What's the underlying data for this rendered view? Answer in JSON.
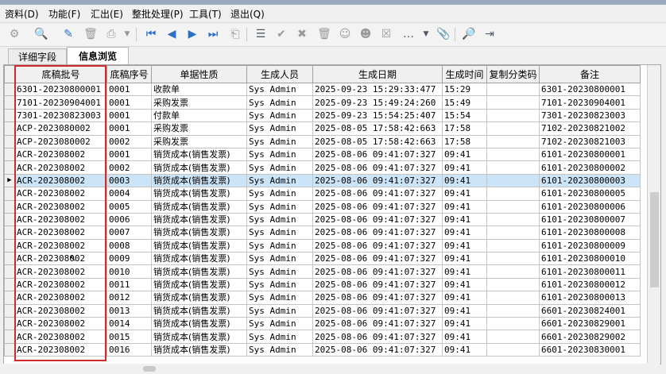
{
  "menu": [
    {
      "label": "资料(D)"
    },
    {
      "label": "功能(F)"
    },
    {
      "label": "汇出(E)"
    },
    {
      "label": "整批处理(P)"
    },
    {
      "label": "工具(T)"
    },
    {
      "label": "退出(Q)"
    }
  ],
  "tabs": [
    {
      "label": "详细字段"
    },
    {
      "label": "信息浏览"
    }
  ],
  "active_tab": "信息浏览",
  "columns": [
    "底稿批号",
    "底稿序号",
    "单据性质",
    "生成人员",
    "生成日期",
    "生成时间",
    "复制分类码",
    "备注"
  ],
  "rows": [
    [
      "6301-20230800001",
      "0001",
      "收款单",
      "Sys Admin",
      "2025-09-23 15:29:33:477",
      "15:29",
      "",
      "6301-20230800001"
    ],
    [
      "7101-20230904001",
      "0001",
      "采购发票",
      "Sys Admin",
      "2025-09-23 15:49:24:260",
      "15:49",
      "",
      "7101-20230904001"
    ],
    [
      "7301-20230823003",
      "0001",
      "付款单",
      "Sys Admin",
      "2025-09-23 15:54:25:407",
      "15:54",
      "",
      "7301-20230823003"
    ],
    [
      "ACP-2023080002",
      "0001",
      "采购发票",
      "Sys Admin",
      "2025-08-05 17:58:42:663",
      "17:58",
      "",
      "7102-20230821002"
    ],
    [
      "ACP-2023080002",
      "0002",
      "采购发票",
      "Sys Admin",
      "2025-08-05 17:58:42:663",
      "17:58",
      "",
      "7102-20230821003"
    ],
    [
      "ACR-202308002",
      "0001",
      "销货成本(销售发票)",
      "Sys Admin",
      "2025-08-06 09:41:07:327",
      "09:41",
      "",
      "6101-20230800001"
    ],
    [
      "ACR-202308002",
      "0002",
      "销货成本(销售发票)",
      "Sys Admin",
      "2025-08-06 09:41:07:327",
      "09:41",
      "",
      "6101-20230800002"
    ],
    [
      "ACR-202308002",
      "0003",
      "销货成本(销售发票)",
      "Sys Admin",
      "2025-08-06 09:41:07:327",
      "09:41",
      "",
      "6101-20230800003"
    ],
    [
      "ACR-202308002",
      "0004",
      "销货成本(销售发票)",
      "Sys Admin",
      "2025-08-06 09:41:07:327",
      "09:41",
      "",
      "6101-20230800005"
    ],
    [
      "ACR-202308002",
      "0005",
      "销货成本(销售发票)",
      "Sys Admin",
      "2025-08-06 09:41:07:327",
      "09:41",
      "",
      "6101-20230800006"
    ],
    [
      "ACR-202308002",
      "0006",
      "销货成本(销售发票)",
      "Sys Admin",
      "2025-08-06 09:41:07:327",
      "09:41",
      "",
      "6101-20230800007"
    ],
    [
      "ACR-202308002",
      "0007",
      "销货成本(销售发票)",
      "Sys Admin",
      "2025-08-06 09:41:07:327",
      "09:41",
      "",
      "6101-20230800008"
    ],
    [
      "ACR-202308002",
      "0008",
      "销货成本(销售发票)",
      "Sys Admin",
      "2025-08-06 09:41:07:327",
      "09:41",
      "",
      "6101-20230800009"
    ],
    [
      "ACR-202308002",
      "0009",
      "销货成本(销售发票)",
      "Sys Admin",
      "2025-08-06 09:41:07:327",
      "09:41",
      "",
      "6101-20230800010"
    ],
    [
      "ACR-202308002",
      "0010",
      "销货成本(销售发票)",
      "Sys Admin",
      "2025-08-06 09:41:07:327",
      "09:41",
      "",
      "6101-20230800011"
    ],
    [
      "ACR-202308002",
      "0011",
      "销货成本(销售发票)",
      "Sys Admin",
      "2025-08-06 09:41:07:327",
      "09:41",
      "",
      "6101-20230800012"
    ],
    [
      "ACR-202308002",
      "0012",
      "销货成本(销售发票)",
      "Sys Admin",
      "2025-08-06 09:41:07:327",
      "09:41",
      "",
      "6101-20230800013"
    ],
    [
      "ACR-202308002",
      "0013",
      "销货成本(销售发票)",
      "Sys Admin",
      "2025-08-06 09:41:07:327",
      "09:41",
      "",
      "6601-20230824001"
    ],
    [
      "ACR-202308002",
      "0014",
      "销货成本(销售发票)",
      "Sys Admin",
      "2025-08-06 09:41:07:327",
      "09:41",
      "",
      "6601-20230829001"
    ],
    [
      "ACR-202308002",
      "0015",
      "销货成本(销售发票)",
      "Sys Admin",
      "2025-08-06 09:41:07:327",
      "09:41",
      "",
      "6601-20230829002"
    ],
    [
      "ACR-202308002",
      "0016",
      "销货成本(销售发票)",
      "Sys Admin",
      "2025-08-06 09:41:07:327",
      "09:41",
      "",
      "6601-20230830001"
    ]
  ],
  "selected_row": 7,
  "toolbar_icons": [
    "settings-doc-icon",
    "search-doc-icon",
    "edit-icon",
    "delete-icon",
    "print-icon",
    "dropdown-icon",
    "first-record-icon",
    "prev-record-icon",
    "next-record-icon",
    "last-record-icon",
    "query-icon",
    "document-icon",
    "approve-icon",
    "reject-icon",
    "trash-icon",
    "user-icon",
    "user-export-icon",
    "clear-doc-icon",
    "more-icon",
    "more-dropdown-icon",
    "attach-icon",
    "preview-icon",
    "export-icon"
  ],
  "colors": {
    "selection": "#cce4f7",
    "highlight_box": "#d22a2a"
  }
}
